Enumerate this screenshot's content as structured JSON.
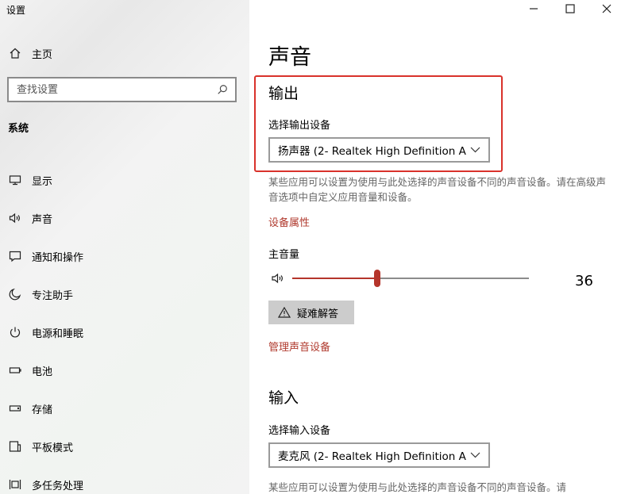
{
  "window": {
    "title": "设置"
  },
  "sidebar": {
    "home_label": "主页",
    "search_placeholder": "查找设置",
    "section_title": "系统",
    "items": [
      {
        "label": "显示",
        "icon": "monitor-icon"
      },
      {
        "label": "声音",
        "icon": "speaker-icon"
      },
      {
        "label": "通知和操作",
        "icon": "notification-icon"
      },
      {
        "label": "专注助手",
        "icon": "moon-icon"
      },
      {
        "label": "电源和睡眠",
        "icon": "power-icon"
      },
      {
        "label": "电池",
        "icon": "battery-icon"
      },
      {
        "label": "存储",
        "icon": "storage-icon"
      },
      {
        "label": "平板模式",
        "icon": "tablet-icon"
      },
      {
        "label": "多任务处理",
        "icon": "multitask-icon"
      }
    ]
  },
  "main": {
    "title": "声音",
    "output": {
      "heading": "输出",
      "select_label": "选择输出设备",
      "select_value": "扬声器 (2- Realtek High Definition A...",
      "description": "某些应用可以设置为使用与此处选择的声音设备不同的声音设备。请在高级声音选项中自定义应用音量和设备。",
      "device_properties_link": "设备属性",
      "volume_label": "主音量",
      "volume_value": "36",
      "volume_fraction": 0.36,
      "troubleshoot_label": "疑难解答",
      "manage_devices_link": "管理声音设备"
    },
    "input": {
      "heading": "输入",
      "select_label": "选择输入设备",
      "select_value": "麦克风 (2- Realtek High Definition A...",
      "description": "某些应用可以设置为使用与此处选择的声音设备不同的声音设备。请"
    }
  },
  "colors": {
    "accent": "#b5352b",
    "highlight_border": "#d9322b",
    "link": "#b03a2e"
  }
}
